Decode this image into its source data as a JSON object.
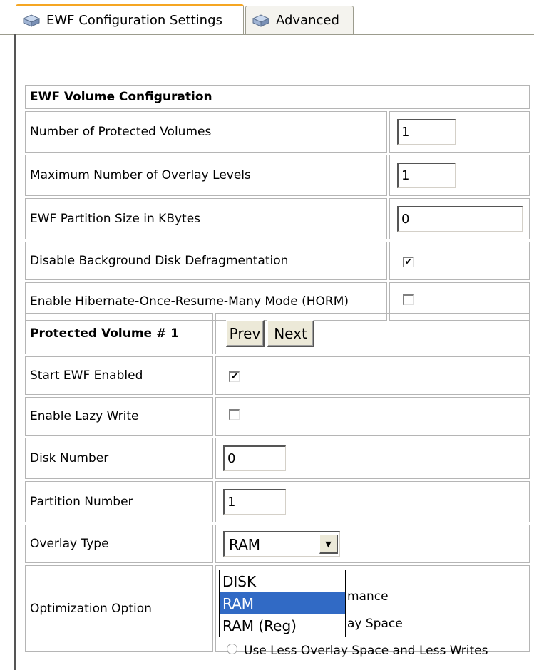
{
  "tabs": [
    {
      "label": "EWF Configuration Settings",
      "icon": "network-drives-icon",
      "active": true
    },
    {
      "label": "Advanced",
      "icon": "network-drives-icon",
      "active": false
    }
  ],
  "volume_config": {
    "header": "EWF Volume Configuration",
    "rows": [
      {
        "label": "Number of Protected Volumes",
        "value": "1"
      },
      {
        "label": "Maximum Number of Overlay Levels",
        "value": "1"
      },
      {
        "label": "EWF Partition Size in KBytes",
        "value": "0"
      },
      {
        "label": "Disable Background Disk Defragmentation",
        "checked": true
      },
      {
        "label": "Enable Hibernate-Once-Resume-Many Mode (HORM)",
        "checked": false
      }
    ]
  },
  "protected_volume": {
    "header": "Protected Volume # 1",
    "prev_label": "Prev",
    "next_label": "Next",
    "start_ewf_label": "Start EWF Enabled",
    "start_ewf_checked": true,
    "lazy_write_label": "Enable Lazy Write",
    "lazy_write_checked": false,
    "disk_number_label": "Disk Number",
    "disk_number_value": "0",
    "partition_number_label": "Partition Number",
    "partition_number_value": "1",
    "overlay_type_label": "Overlay Type",
    "overlay_type_value": "RAM",
    "overlay_options": [
      "DISK",
      "RAM",
      "RAM (Reg)"
    ],
    "overlay_highlighted": "RAM",
    "optimization_label": "Optimization Option",
    "optimization_visible_text": [
      "mance",
      "ay Space",
      "Use Less Overlay Space and Less Writes"
    ]
  },
  "colors": {
    "selection": "#316ac5",
    "tab_accent": "#f5a623",
    "button_face": "#ece9d8"
  }
}
